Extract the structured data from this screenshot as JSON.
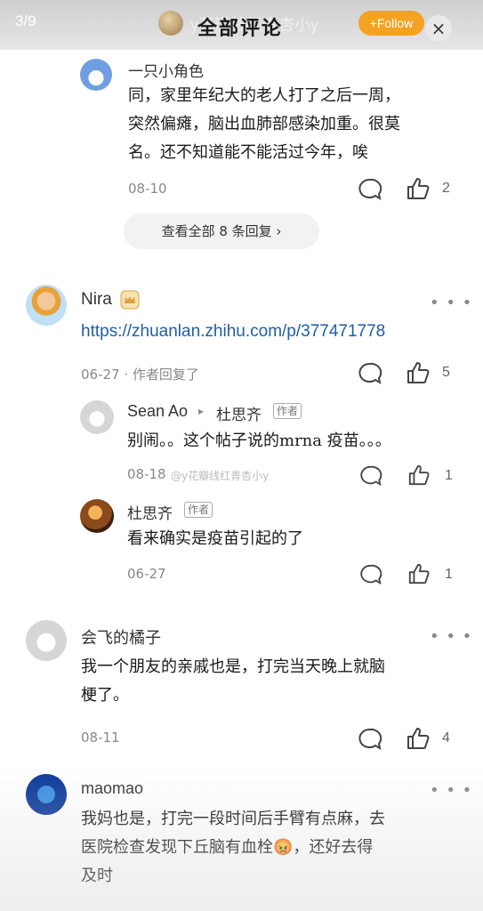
{
  "header": {
    "counter": "3/9",
    "author_name": "y花瓣线红青杏小y",
    "title": "全部评论",
    "follow_label": "+Follow",
    "close_symbol": "×"
  },
  "comment1": {
    "name": "一只小角色",
    "text_lines": [
      "同，家里年纪大的老人打了之后一周，",
      "突然偏瘫，脑出血肺部感染加重。很莫",
      "名。还不知道能不能活过今年，唉"
    ],
    "date": "08-10",
    "likes": "2",
    "view_replies": "查看全部 8 条回复 ›"
  },
  "comment2": {
    "name": "Nira",
    "link": "https://zhuanlan.zhihu.com/p/377471778",
    "date": "06-27 · 作者回复了",
    "likes": "5",
    "replies": [
      {
        "name": "Sean Ao",
        "arrow": "▸",
        "reply_to": "杜思齐",
        "badge": "作者",
        "text": "别闹。。这个帖子说的mrna 疫苗。。。",
        "date": "08-18",
        "likes": "1"
      },
      {
        "name": "杜思齐",
        "badge": "作者",
        "text": "看来确实是疫苗引起的了",
        "date": "06-27",
        "likes": "1"
      }
    ]
  },
  "watermark": "@y花瓣线红青杏小y",
  "comment3": {
    "name": "会飞的橘子",
    "text_lines": [
      "我一个朋友的亲戚也是，打完当天晚上就脑",
      "梗了。"
    ],
    "date": "08-11",
    "likes": "4"
  },
  "comment4": {
    "name": "maomao",
    "text_lines": [
      "我妈也是，打完一段时间后手臂有点麻，去",
      "医院检查发现下丘脑有血栓😡，还好去得",
      "及时"
    ]
  },
  "more_symbol": "• • •"
}
